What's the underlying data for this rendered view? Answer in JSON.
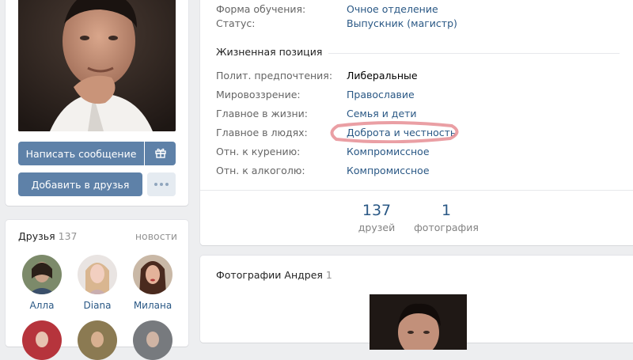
{
  "profile": {
    "avatar_alt": "",
    "message_button": "Написать сообщение",
    "add_friend_button": "Добавить в друзья"
  },
  "friends": {
    "title": "Друзья",
    "count": "137",
    "news_link": "новости",
    "items": [
      {
        "name": "Алла"
      },
      {
        "name": "Diana"
      },
      {
        "name": "Милана"
      }
    ]
  },
  "education": {
    "rows": [
      {
        "label": "Форма обучения:",
        "value": "Очное отделение"
      },
      {
        "label": "Статус:",
        "value": "Выпускник (магистр)"
      }
    ]
  },
  "life_position": {
    "title": "Жизненная позиция",
    "rows": [
      {
        "label": "Полит. предпочтения:",
        "value": "Либеральные"
      },
      {
        "label": "Мировоззрение:",
        "value": "Православие"
      },
      {
        "label": "Главное в жизни:",
        "value": "Семья и дети"
      },
      {
        "label": "Главное в людях:",
        "value": "Доброта и честность"
      },
      {
        "label": "Отн. к курению:",
        "value": "Компромиссное"
      },
      {
        "label": "Отн. к алкоголю:",
        "value": "Компромиссное"
      }
    ]
  },
  "counters": [
    {
      "number": "137",
      "caption": "друзей"
    },
    {
      "number": "1",
      "caption": "фотография"
    }
  ],
  "photos": {
    "title": "Фотографии Андрея",
    "count": "1"
  },
  "colors": {
    "accent": "#5e81a8",
    "link": "#2a5885",
    "highlight": "#e8959a"
  },
  "icons": [
    "gift-icon",
    "more-dots-icon"
  ]
}
